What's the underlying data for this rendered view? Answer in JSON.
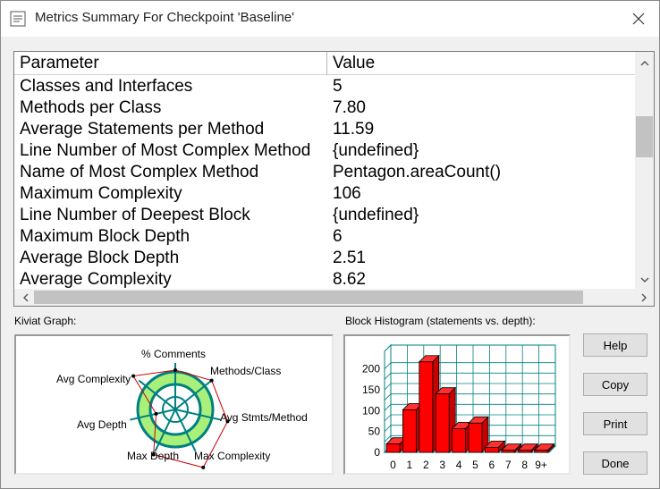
{
  "window": {
    "title": "Metrics Summary For Checkpoint 'Baseline'"
  },
  "table": {
    "headers": {
      "parameter": "Parameter",
      "value": "Value"
    },
    "rows": [
      {
        "parameter": "Classes and Interfaces",
        "value": "5"
      },
      {
        "parameter": "Methods per Class",
        "value": "7.80"
      },
      {
        "parameter": "Average Statements per Method",
        "value": "11.59"
      },
      {
        "parameter": "Line Number of Most Complex Method",
        "value": "{undefined}"
      },
      {
        "parameter": "Name of Most Complex Method",
        "value": "Pentagon.areaCount()"
      },
      {
        "parameter": "Maximum Complexity",
        "value": "106"
      },
      {
        "parameter": "Line Number of Deepest Block",
        "value": "{undefined}"
      },
      {
        "parameter": "Maximum Block Depth",
        "value": "6"
      },
      {
        "parameter": "Average Block Depth",
        "value": "2.51"
      },
      {
        "parameter": "Average Complexity",
        "value": "8.62"
      }
    ]
  },
  "kiviat": {
    "label": "Kiviat Graph:",
    "axes": [
      "% Comments",
      "Methods/Class",
      "Avg Stmts/Method",
      "Max Complexity",
      "Max Depth",
      "Avg Depth",
      "Avg Complexity"
    ],
    "colors": {
      "band": "#a8f07a",
      "spokes": "#008080",
      "outline": "#cc0000"
    }
  },
  "histogram": {
    "label": "Block Histogram (statements vs. depth):",
    "chart_data": {
      "type": "bar",
      "categories": [
        "0",
        "1",
        "2",
        "3",
        "4",
        "5",
        "6",
        "7",
        "8",
        "9+"
      ],
      "values": [
        20,
        102,
        217,
        140,
        57,
        70,
        12,
        5,
        5,
        5
      ],
      "yticks": [
        "0",
        "50",
        "100",
        "150",
        "200"
      ],
      "ylim": [
        0,
        225
      ],
      "bar_color": "#ff0000",
      "grid_color": "#008080"
    }
  },
  "buttons": {
    "help": "Help",
    "copy": "Copy",
    "print": "Print",
    "done": "Done"
  }
}
